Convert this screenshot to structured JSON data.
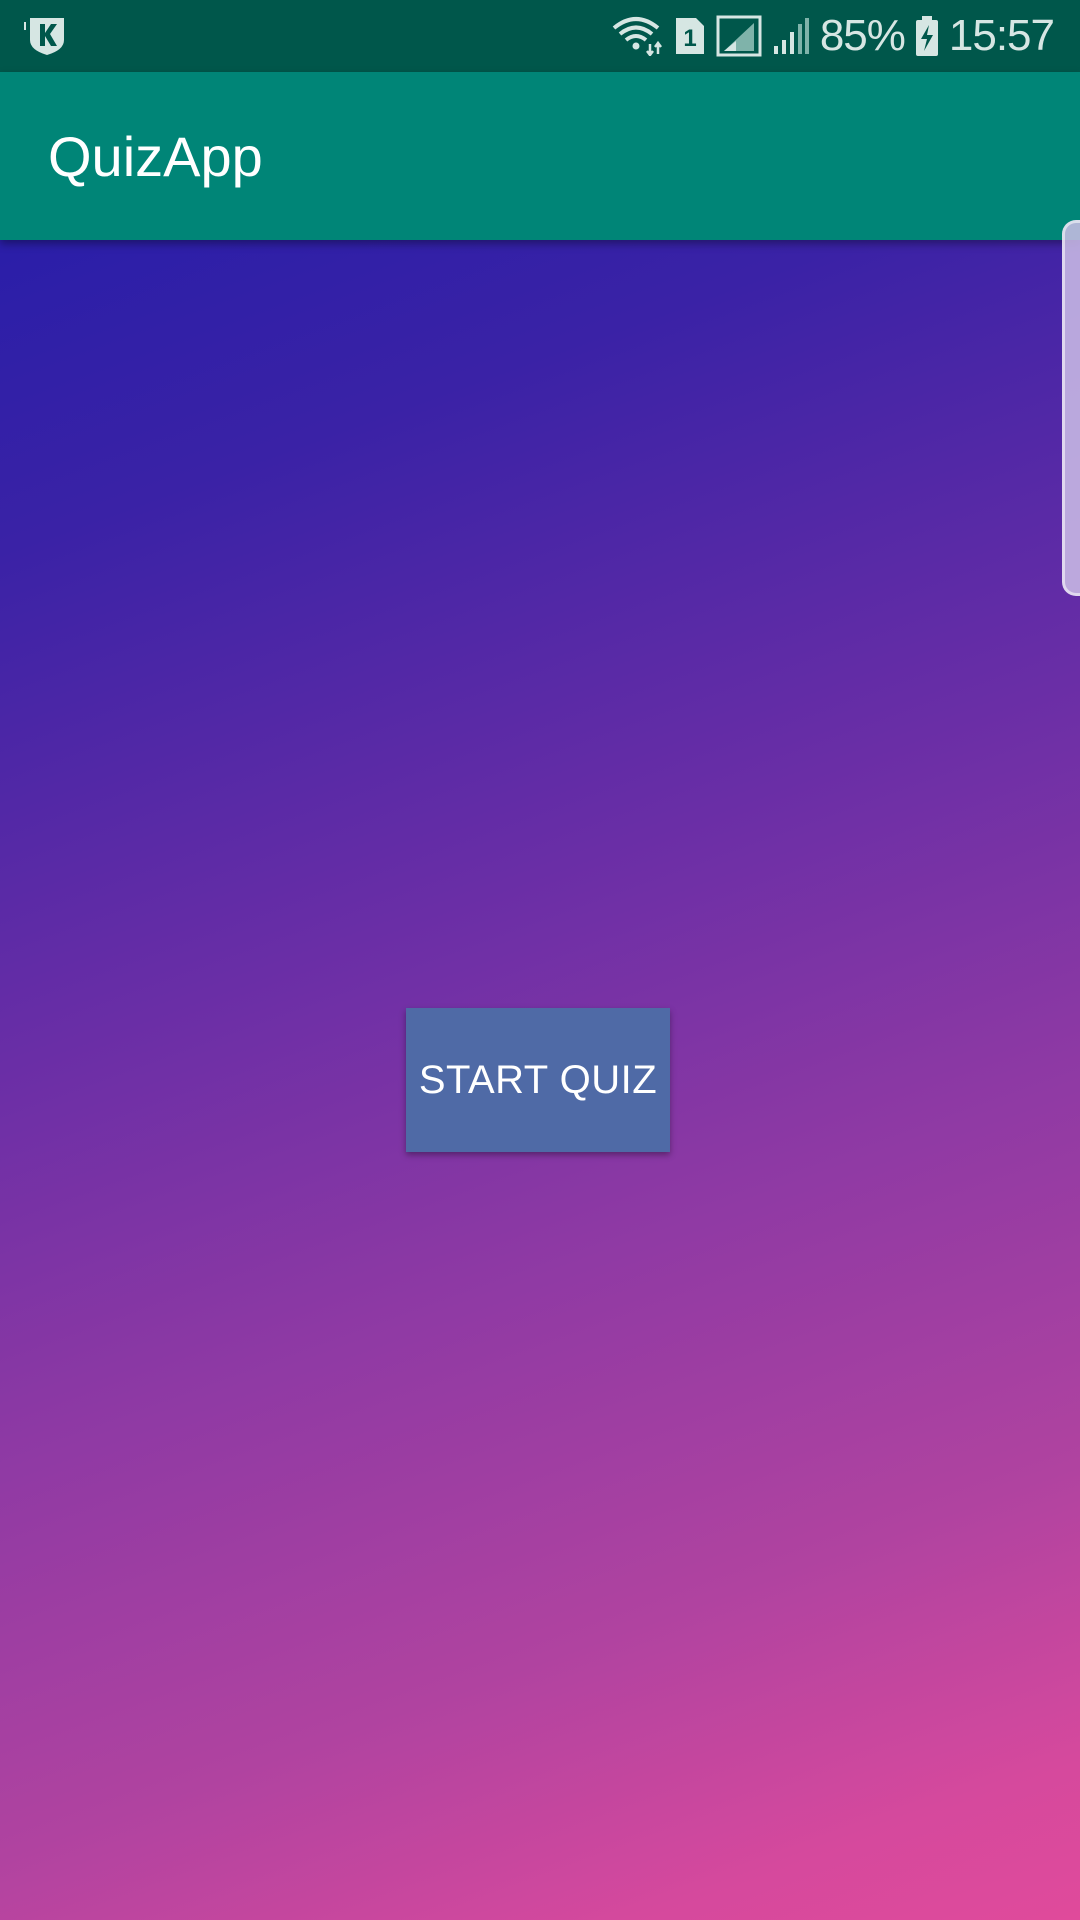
{
  "status_bar": {
    "battery_percent": "85%",
    "time": "15:57",
    "sim_slot": "1",
    "icons": [
      "kaspersky-icon",
      "wifi-icon",
      "sim-icon",
      "signal-icon",
      "signal-weak-icon",
      "battery-charging-icon"
    ]
  },
  "app_bar": {
    "title": "QuizApp"
  },
  "main": {
    "start_button_label": "START QUIZ"
  },
  "colors": {
    "status_bar": "#00574B",
    "app_bar": "#008577",
    "gradient_start": "#2a1ea8",
    "gradient_end": "#e04a9b",
    "button": "#4f6aa6"
  }
}
